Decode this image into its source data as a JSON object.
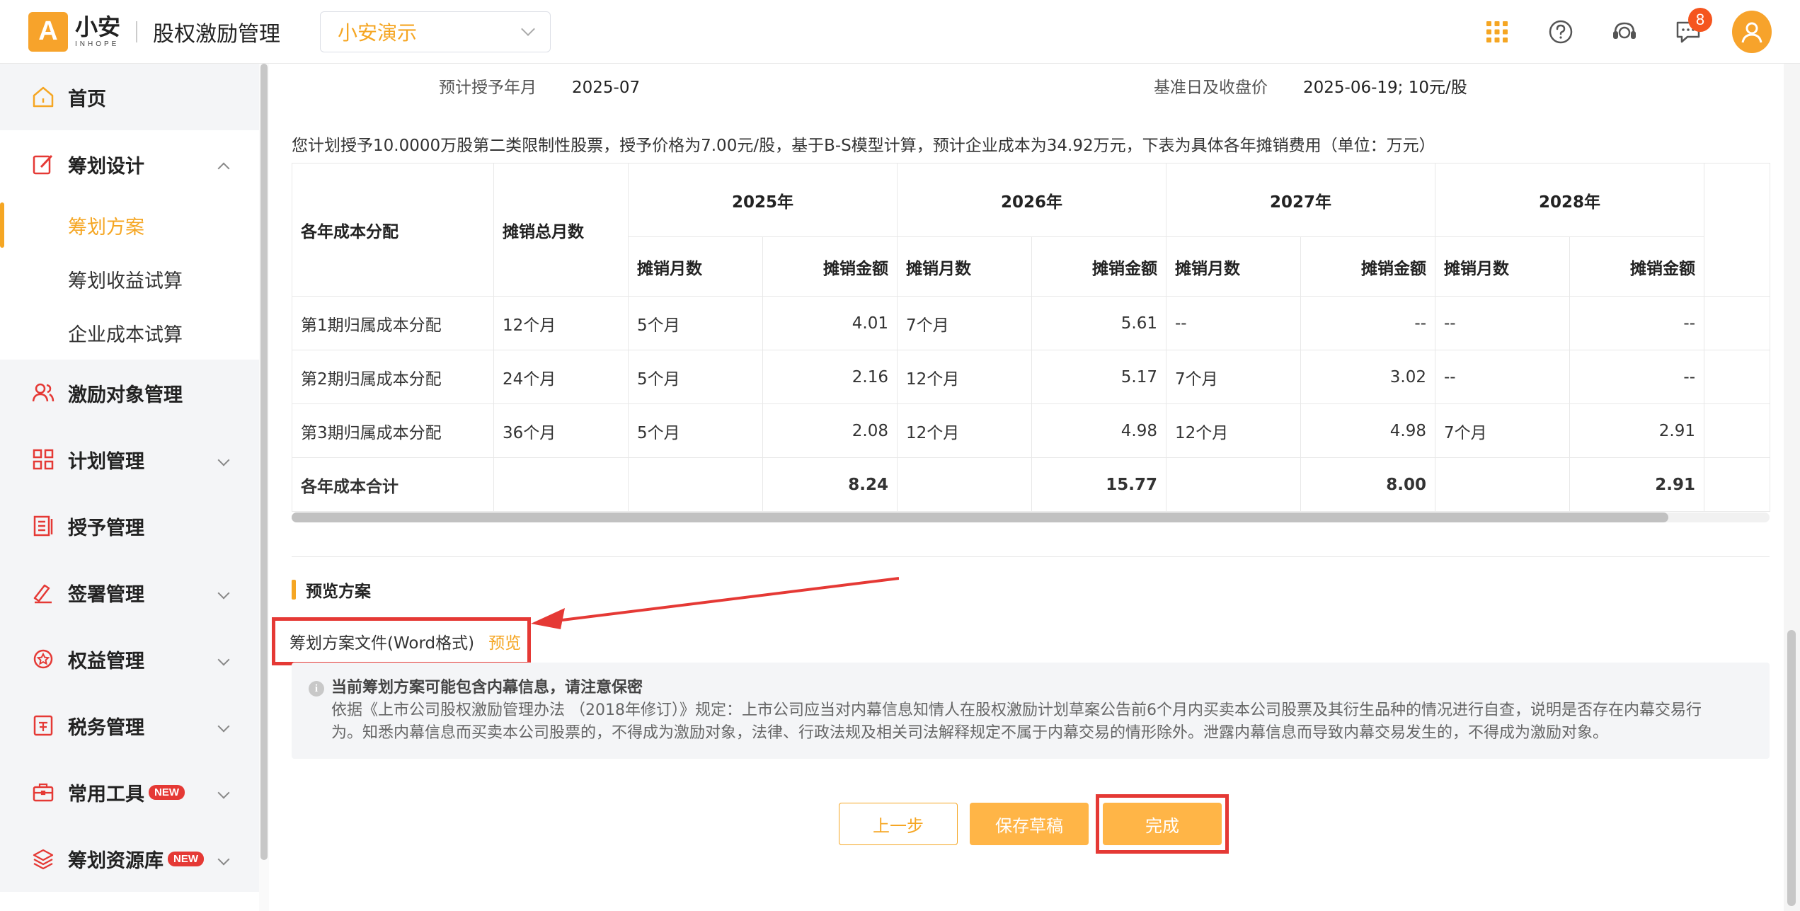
{
  "header": {
    "logo_mark": "A",
    "logo_cn": "小安",
    "logo_en": "INHOPE",
    "app_title": "股权激励管理",
    "company": "小安演示",
    "notification_count": "8"
  },
  "sidebar": {
    "home": "首页",
    "planning": "筹划设计",
    "planning_sub": [
      "筹划方案",
      "筹划收益试算",
      "企业成本试算"
    ],
    "incentive_targets": "激励对象管理",
    "plan_mgmt": "计划管理",
    "grant_mgmt": "授予管理",
    "sign_mgmt": "签署管理",
    "rights_mgmt": "权益管理",
    "tax_mgmt": "税务管理",
    "tools": "常用工具",
    "resources": "筹划资源库",
    "new_tag": "NEW"
  },
  "info": {
    "grant_month_label": "预计授予年月",
    "grant_month_value": "2025-07",
    "base_date_label": "基准日及收盘价",
    "base_date_value": "2025-06-19; 10元/股"
  },
  "description": "您计划授予10.0000万股第二类限制性股票，授予价格为7.00元/股，基于B-S模型计算，预计企业成本为34.92万元，下表为具体各年摊销费用（单位：万元）",
  "table": {
    "col_dist": "各年成本分配",
    "col_total_months": "摊销总月数",
    "years": [
      "2025年",
      "2026年",
      "2027年",
      "2028年"
    ],
    "sub_months": "摊销月数",
    "sub_amount": "摊销金额",
    "rows": [
      {
        "name": "第1期归属成本分配",
        "total": "12个月",
        "cells": [
          "5个月",
          "4.01",
          "7个月",
          "5.61",
          "--",
          "--",
          "--",
          "--"
        ]
      },
      {
        "name": "第2期归属成本分配",
        "total": "24个月",
        "cells": [
          "5个月",
          "2.16",
          "12个月",
          "5.17",
          "7个月",
          "3.02",
          "--",
          "--"
        ]
      },
      {
        "name": "第3期归属成本分配",
        "total": "36个月",
        "cells": [
          "5个月",
          "2.08",
          "12个月",
          "4.98",
          "12个月",
          "4.98",
          "7个月",
          "2.91"
        ]
      }
    ],
    "total_row": {
      "name": "各年成本合计",
      "values": [
        "8.24",
        "15.77",
        "8.00",
        "2.91"
      ]
    }
  },
  "preview": {
    "section_title": "预览方案",
    "file_label": "筹划方案文件(Word格式)",
    "preview_link": "预览"
  },
  "notice": {
    "title": "当前筹划方案可能包含内幕信息，请注意保密",
    "line1": "依据《上市公司股权激励管理办法 （2018年修订）》规定：上市公司应当对内幕信息知情人在股权激励计划草案公告前6个月内买卖本公司股票及其衍生品种的情况进行自查，说明是否存在内幕交易行",
    "line2": "为。知悉内幕信息而买卖本公司股票的，不得成为激励对象，法律、行政法规及相关司法解释规定不属于内幕交易的情形除外。泄露内幕信息而导致内幕交易发生的，不得成为激励对象。"
  },
  "buttons": {
    "prev": "上一步",
    "save_draft": "保存草稿",
    "done": "完成"
  },
  "colors": {
    "accent": "#f5a623",
    "annotation": "#e53935"
  }
}
